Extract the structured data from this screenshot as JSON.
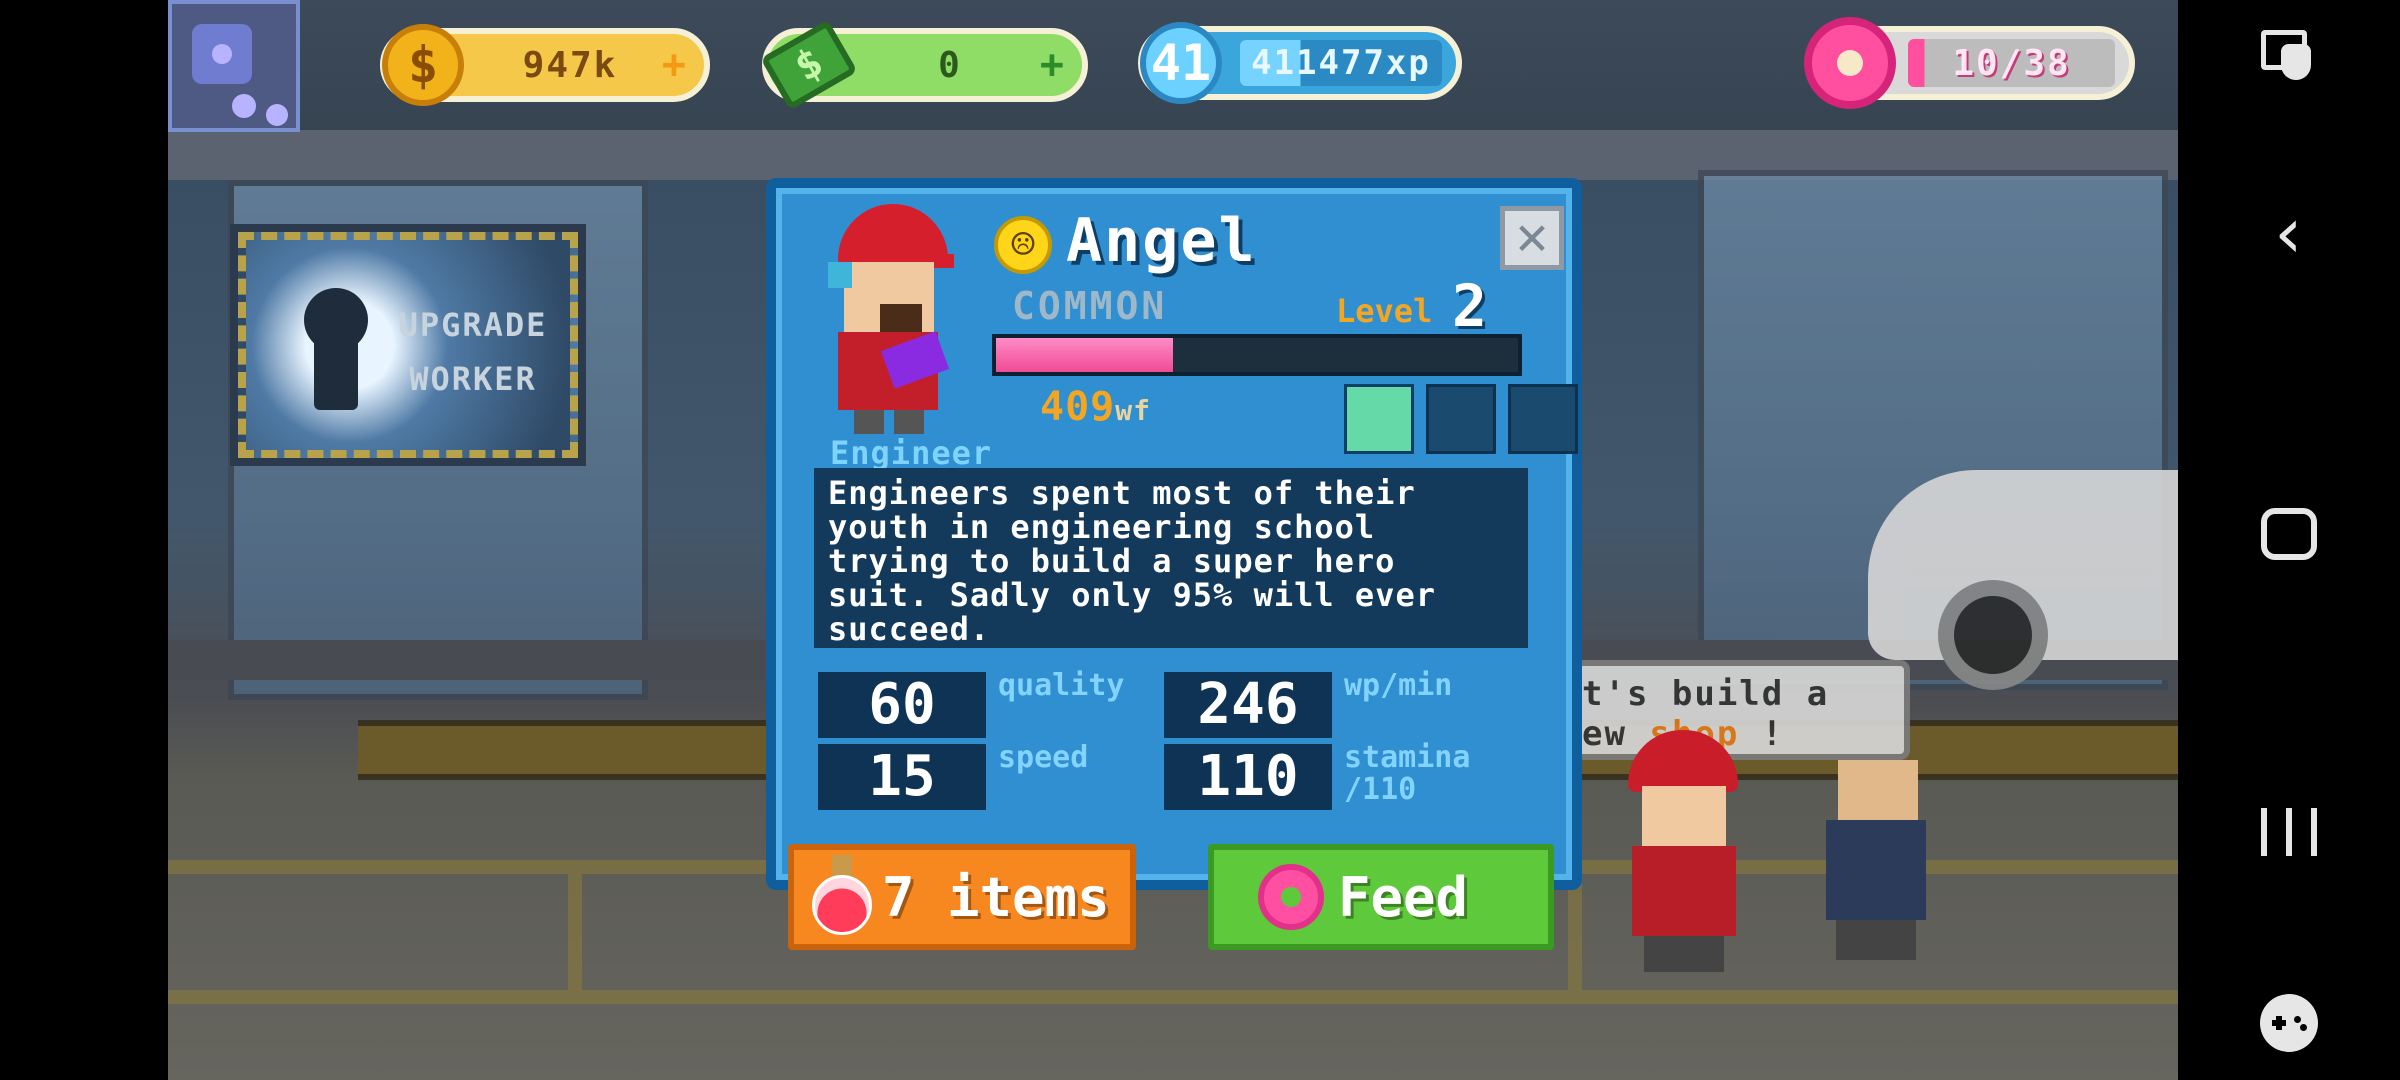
{
  "hud": {
    "coins": {
      "icon": "coin-icon",
      "symbol": "$",
      "value": "947k",
      "plus": "+"
    },
    "cash": {
      "icon": "cash-icon",
      "symbol": "$",
      "value": "0",
      "plus": "+"
    },
    "xp": {
      "icon": "level-badge-icon",
      "level": "41",
      "value": "411477xp"
    },
    "donuts": {
      "icon": "donut-icon",
      "value": "10/38"
    }
  },
  "background": {
    "upgrade_sign": {
      "line1": "UPGRADE",
      "line2": "WORKER"
    },
    "speech_bubble": {
      "line1": "t's build a",
      "line2_prefix": "ew ",
      "line2_highlight": "shop",
      "line2_suffix": " !"
    }
  },
  "modal": {
    "mood_icon": "sad-face-icon",
    "mood_glyph": "☹",
    "name": "Angel",
    "rarity": "COMMON",
    "level_label": "Level",
    "level_value": "2",
    "level_progress": 0.34,
    "wf_value": "409",
    "wf_unit": "wf",
    "stars": {
      "filled": 1,
      "total": 3
    },
    "role": "Engineer",
    "description": "Engineers spent most of their youth in engineering school trying to build a super hero suit. Sadly only 95% will ever succeed.",
    "stats": {
      "quality": {
        "value": "60",
        "label": "quality"
      },
      "wp_min": {
        "value": "246",
        "label": "wp/min"
      },
      "speed": {
        "value": "15",
        "label": "speed"
      },
      "stamina": {
        "value": "110",
        "label_line1": "stamina",
        "label_line2": "/110"
      }
    },
    "close_glyph": "✕",
    "items_button": {
      "icon": "potion-icon",
      "label": "7 items"
    },
    "feed_button": {
      "icon": "donut-icon",
      "label": "Feed"
    }
  },
  "navbar": {
    "icons": [
      "screen-edit-icon",
      "back-icon",
      "home-icon",
      "recents-icon",
      "game-controller-icon"
    ],
    "back_glyph": "‹"
  }
}
